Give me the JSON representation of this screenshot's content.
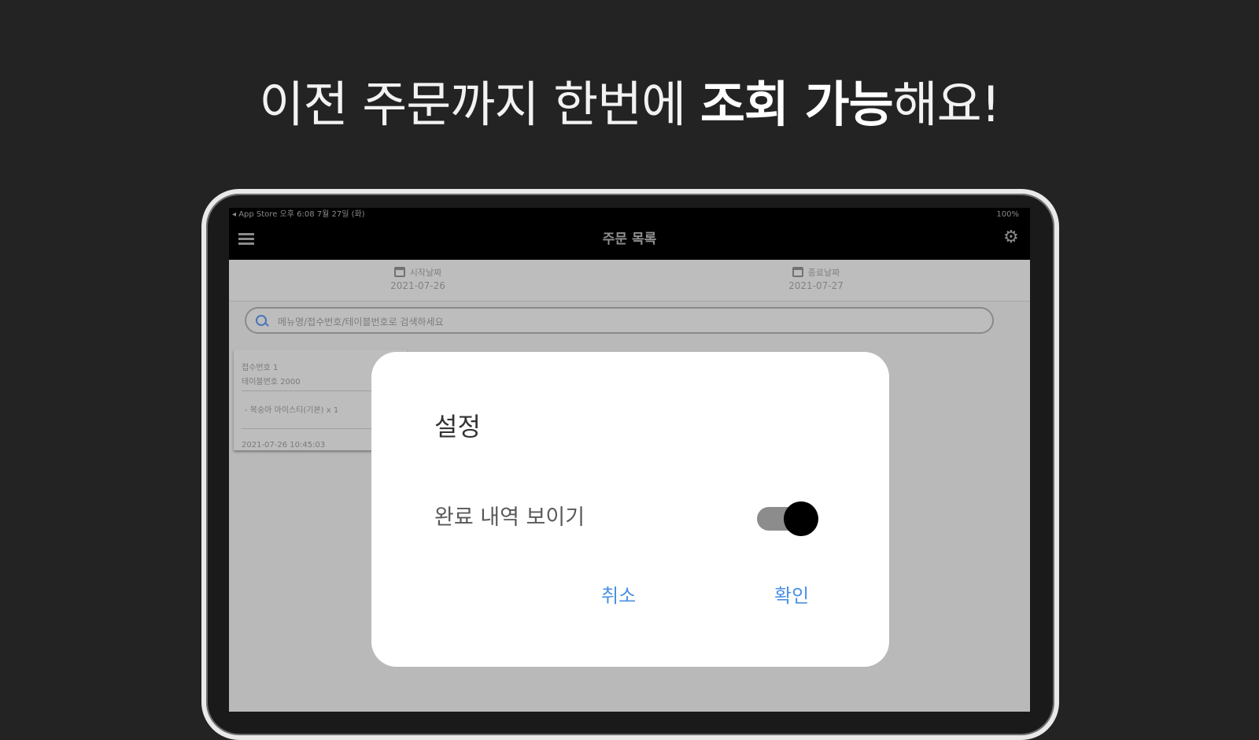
{
  "banner": {
    "part1": "이전 주문까지 한번에 ",
    "bold": "조회 가능",
    "part2": "해요!"
  },
  "status_bar": {
    "left": "◂ App Store  오후 6:08  7월 27일 (화)",
    "right": "100%"
  },
  "app_bar": {
    "title": "주문 목록",
    "menu_icon": "hamburger-icon",
    "settings_icon": "gear-icon"
  },
  "dates": {
    "start_label": "시작날짜",
    "start_value": "2021-07-26",
    "end_label": "종료날짜",
    "end_value": "2021-07-27"
  },
  "search": {
    "placeholder": "메뉴명/접수번호/테이블번호로 검색하세요"
  },
  "order_card": {
    "receipt": "접수번호 1",
    "table": "테이블번호 2000",
    "item": "- 복숭아 아이스티(기본) x 1",
    "datetime": "2021-07-26 10:45:03"
  },
  "dialog": {
    "title": "설정",
    "option_label": "완료 내역 보이기",
    "toggle_on": true,
    "cancel": "취소",
    "confirm": "확인",
    "accent_color": "#4a90e2"
  }
}
